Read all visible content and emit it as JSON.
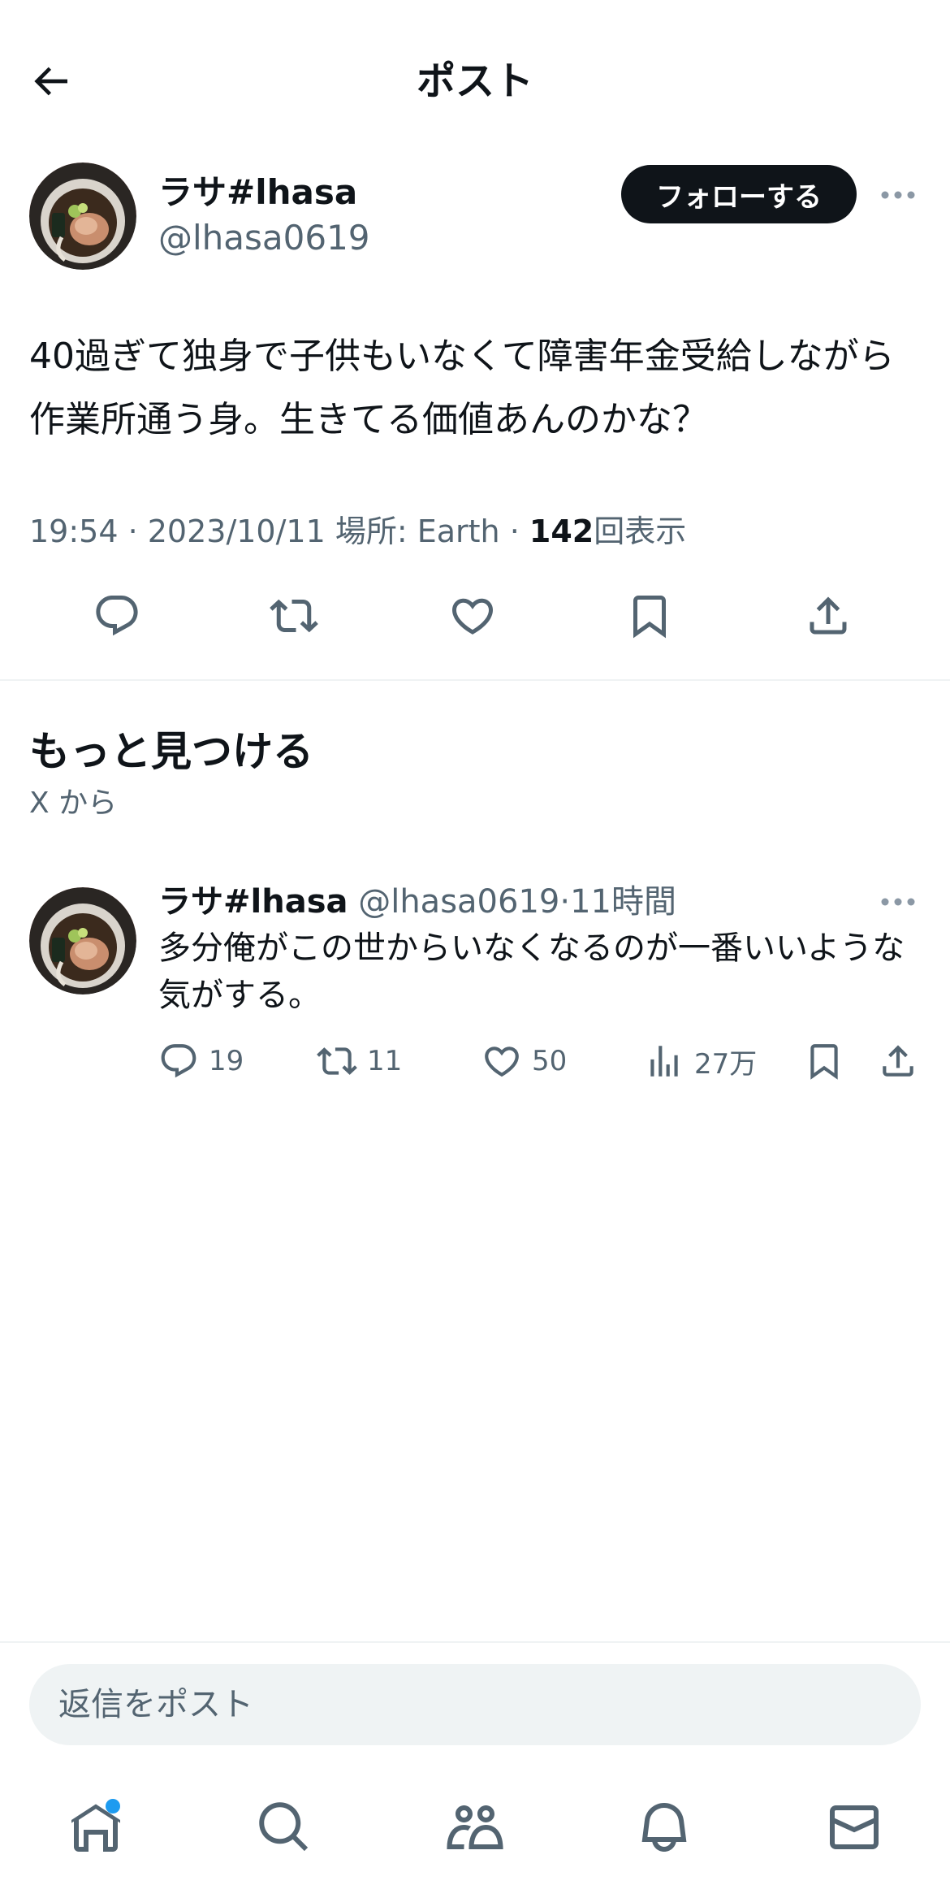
{
  "header": {
    "title": "ポスト"
  },
  "post": {
    "author_name": "ラサ#lhasa",
    "author_handle": "@lhasa0619",
    "follow_label": "フォローする",
    "text": "40過ぎて独身で子供もいなくて障害年金受給しながら作業所通う身。生きてる価値あんのかな？",
    "meta_prefix": "19:54 · 2023/10/11 場所: Earth · ",
    "views_count": "142",
    "views_suffix": "回表示",
    "actions": [
      "reply-icon",
      "repost-icon",
      "like-icon",
      "bookmark-icon",
      "share-icon"
    ]
  },
  "discover": {
    "title": "もっと見つける",
    "subtitle": "X から"
  },
  "recommended": {
    "author_name": "ラサ#lhasa",
    "author_handle": "@lhasa0619",
    "dot": "·",
    "time": "11時間",
    "text": "多分俺がこの世からいなくなるのが一番いいような気がする。",
    "replies": "19",
    "reposts": "11",
    "likes": "50",
    "views": "27万"
  },
  "reply_bar": {
    "placeholder": "返信をポスト"
  },
  "bottom_nav": [
    "home-icon",
    "search-icon",
    "communities-icon",
    "notifications-icon",
    "messages-icon"
  ],
  "colors": {
    "text_primary": "#0f1419",
    "text_secondary": "#536471",
    "divider": "#eff3f4",
    "accent": "#1d9bf0",
    "follow_bg": "#0f1419"
  }
}
